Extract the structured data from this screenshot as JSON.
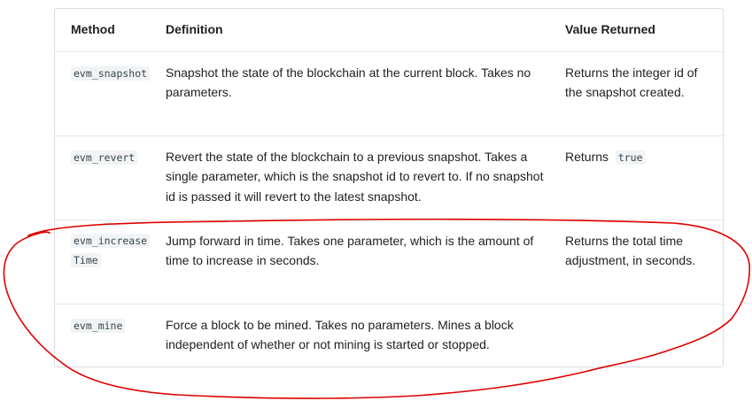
{
  "table": {
    "headers": {
      "method": "Method",
      "definition": "Definition",
      "value_returned": "Value Returned"
    },
    "rows": [
      {
        "method": "evm_snapshot",
        "definition": "Snapshot the state of the blockchain at the current block. Takes no parameters.",
        "returned_text": "Returns the integer id of the snapshot created.",
        "returned_code": ""
      },
      {
        "method": "evm_revert",
        "definition": "Revert the state of the blockchain to a previous snapshot. Takes a single parameter, which is the snapshot id to revert to. If no snapshot id is passed it will revert to the latest snapshot.",
        "returned_text": "Returns",
        "returned_code": "true"
      },
      {
        "method": "evm_increaseTime",
        "definition": "Jump forward in time. Takes one parameter, which is the amount of time to increase in seconds.",
        "returned_text": "Returns the total time adjustment, in seconds.",
        "returned_code": ""
      },
      {
        "method": "evm_mine",
        "definition": "Force a block to be mined. Takes no parameters. Mines a block independent of whether or not mining is started or stopped.",
        "returned_text": "",
        "returned_code": ""
      }
    ]
  },
  "annotation": {
    "color": "#e00000"
  }
}
